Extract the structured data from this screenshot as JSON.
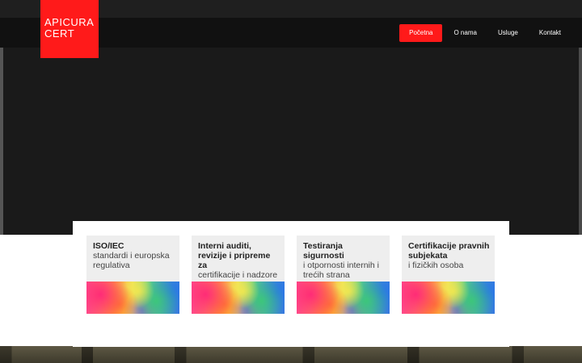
{
  "logo": {
    "line1": "APICURA",
    "line2": "CERT"
  },
  "nav": {
    "items": [
      {
        "label": "Početna",
        "active": true
      },
      {
        "label": "O nama",
        "active": false
      },
      {
        "label": "Usluge",
        "active": false
      },
      {
        "label": "Kontakt",
        "active": false
      }
    ]
  },
  "cards": [
    {
      "title": "ISO/IEC",
      "desc": "standardi i europska regulativa"
    },
    {
      "title": "Interni auditi, revizije i pripreme za",
      "desc": "certifikacije i nadzore"
    },
    {
      "title": "Testiranja sigurnosti",
      "desc": "i otpornosti internih i trećih strana"
    },
    {
      "title": "Certifikacije pravnih subjekata",
      "desc": "i fizičkih osoba"
    }
  ],
  "colors": {
    "accent": "#ff1a1a",
    "navbar": "#111111",
    "hero": "#1a1a1a",
    "card": "#eeeeee"
  }
}
